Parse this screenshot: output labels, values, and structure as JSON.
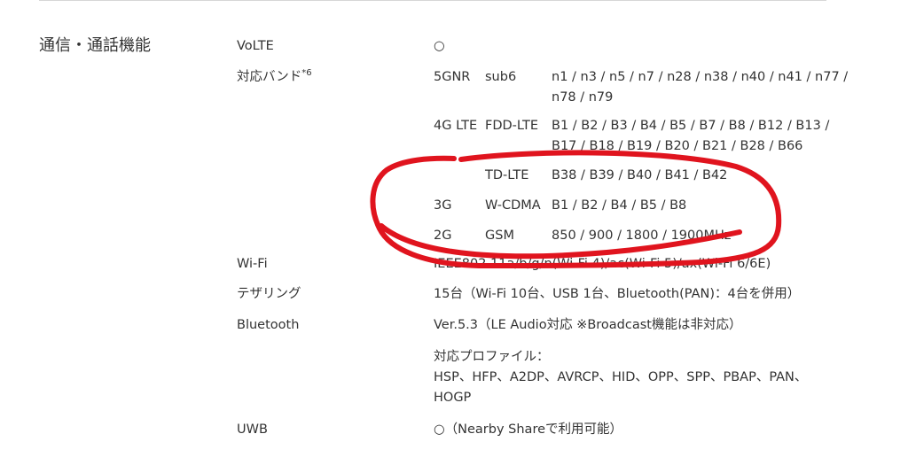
{
  "section": {
    "title": "通信・通話機能"
  },
  "volte": {
    "label": "VoLTE",
    "value": "○"
  },
  "bands": {
    "label": "対応バンド",
    "note": "*6",
    "rows": [
      {
        "tech": "5GNR",
        "type": "sub6",
        "line1": "n1 / n3 / n5 / n7 / n28 / n38 / n40 / n41 / n77 /",
        "line2": "n78 / n79"
      },
      {
        "tech": "4G LTE",
        "type": "FDD-LTE",
        "line1": "B1 / B2 / B3 / B4 / B5 / B7 / B8 / B12 / B13 /",
        "line2": "B17 / B18 / B19 / B20 / B21 / B28 / B66"
      },
      {
        "tech": "",
        "type": "TD-LTE",
        "line1": "B38 / B39 / B40 / B41 / B42"
      },
      {
        "tech": "3G",
        "type": "W-CDMA",
        "line1": "B1 / B2 / B4 / B5 / B8"
      },
      {
        "tech": "2G",
        "type": "GSM",
        "line1": "850 / 900 / 1800 / 1900MHz"
      }
    ]
  },
  "wifi": {
    "label": "Wi-Fi",
    "value": "IEEE802.11a/b/g/n(Wi-Fi 4)/ac(Wi-Fi 5)/ax(Wi-Fi 6/6E)"
  },
  "tethering": {
    "label": "テザリング",
    "value": "15台（Wi-Fi 10台、USB 1台、Bluetooth(PAN)：4台を併用）"
  },
  "bluetooth": {
    "label": "Bluetooth",
    "version": "Ver.5.3（LE Audio対応 ※Broadcast機能は非対応）",
    "profiles_title": "対応プロファイル：",
    "profiles_line1": "HSP、HFP、A2DP、AVRCP、HID、OPP、SPP、PBAP、PAN、",
    "profiles_line2": "HOGP"
  },
  "uwb": {
    "label": "UWB",
    "value": "○（Nearby Shareで利用可能）"
  },
  "annotation": {
    "color": "#e0141e"
  }
}
